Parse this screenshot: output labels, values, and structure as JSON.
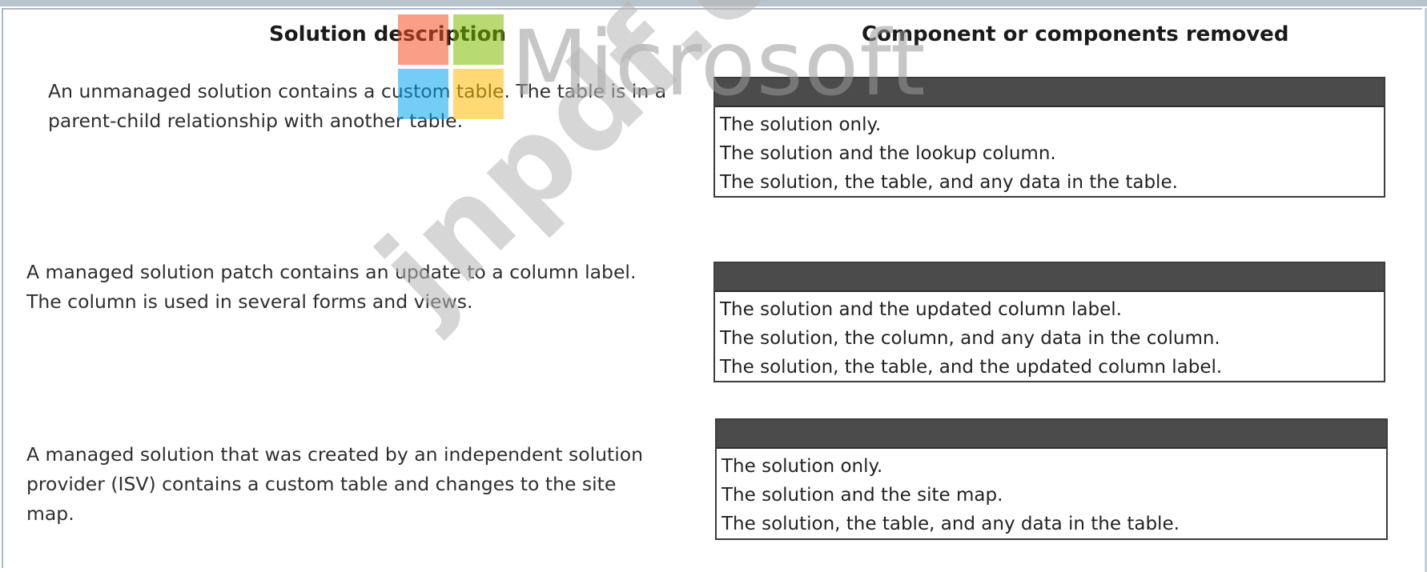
{
  "headers": {
    "left": "Solution description",
    "right": "Component or components removed"
  },
  "rows": [
    {
      "description": "An unmanaged solution contains a custom table. The table is in a parent-child relationship with another table.",
      "options": [
        "The solution only.",
        "The solution and the lookup column.",
        "The solution, the table, and any data in the table."
      ]
    },
    {
      "description": "A managed solution patch contains an update to a column label. The column is used in several forms and views.",
      "options": [
        "The solution and the updated column label.",
        "The solution, the column, and any data in the column.",
        "The solution, the table, and the updated column label."
      ]
    },
    {
      "description": "A managed solution that was created by an independent solution provider (ISV) contains a custom table and changes to the site map.",
      "options": [
        "The solution only.",
        "The solution and the site map.",
        "The solution, the table, and any data in the table."
      ]
    }
  ],
  "overlays": {
    "logo_text": "Microsoft",
    "watermark_text": "jnpdf.com",
    "logo_colors": [
      "#f25022",
      "#7fba00",
      "#00a4ef",
      "#ffb900"
    ]
  }
}
